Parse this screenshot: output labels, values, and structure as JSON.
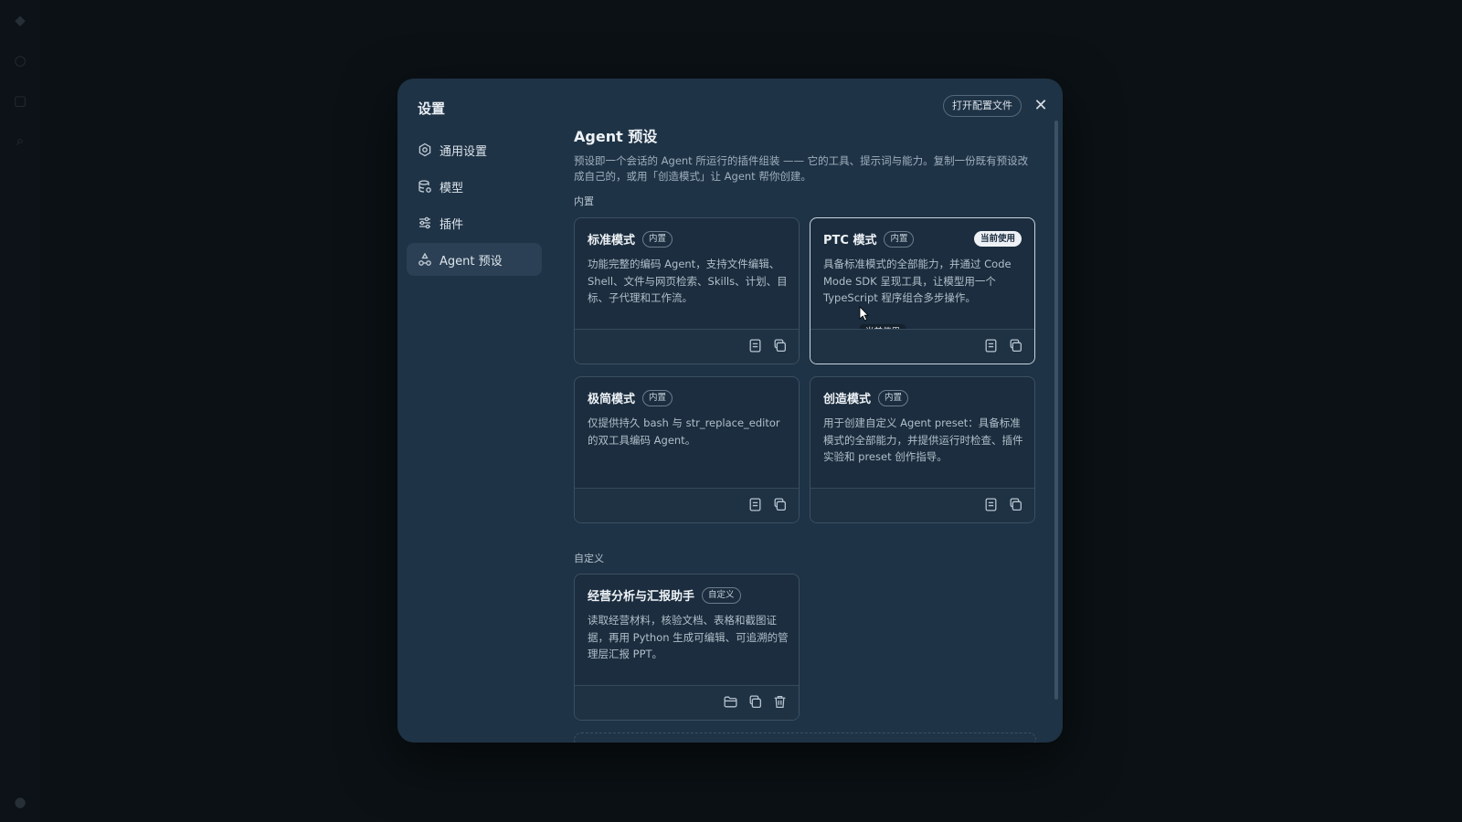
{
  "dialog": {
    "title": "设置",
    "open_config_label": "打开配置文件",
    "close_icon": "close-icon"
  },
  "sidebar": {
    "items": [
      {
        "label": "通用设置",
        "icon": "gear-icon",
        "active": false
      },
      {
        "label": "模型",
        "icon": "database-icon",
        "active": false
      },
      {
        "label": "插件",
        "icon": "sliders-icon",
        "active": false
      },
      {
        "label": "Agent 预设",
        "icon": "agent-icon",
        "active": true
      }
    ]
  },
  "main": {
    "title": "Agent 预设",
    "description": "预设即一个会话的 Agent 所运行的插件组装 —— 它的工具、提示词与能力。复制一份既有预设改成自己的，或用「创造模式」让 Agent 帮你创建。",
    "builtin_label": "内置",
    "custom_label": "自定义",
    "builtin_cards": [
      {
        "name": "标准模式",
        "tag": "内置",
        "description": "功能完整的编码 Agent，支持文件编辑、Shell、文件与网页检索、Skills、计划、目标、子代理和工作流。",
        "current": false
      },
      {
        "name": "PTC 模式",
        "tag": "内置",
        "badge": "当前使用",
        "description": "具备标准模式的全部能力，并通过 Code Mode SDK 呈现工具，让模型用一个 TypeScript 程序组合多步操作。",
        "tooltip": "当前使用",
        "current": true
      },
      {
        "name": "极简模式",
        "tag": "内置",
        "description": "仅提供持久 bash 与 str_replace_editor 的双工具编码 Agent。",
        "current": false
      },
      {
        "name": "创造模式",
        "tag": "内置",
        "description": "用于创建自定义 Agent preset：具备标准模式的全部能力，并提供运行时检查、插件实验和 preset 创作指导。",
        "current": false
      }
    ],
    "custom_cards": [
      {
        "name": "经营分析与汇报助手",
        "tag": "自定义",
        "description": "读取经营材料，核验文档、表格和截图证据，再用 Python 生成可编辑、可追溯的管理层汇报 PPT。"
      }
    ]
  },
  "colors": {
    "modal_bg": "#1f3346",
    "card_bg": "#1b2d3e",
    "card_border": "#3a5063",
    "badge_bg": "#eef2f6"
  }
}
